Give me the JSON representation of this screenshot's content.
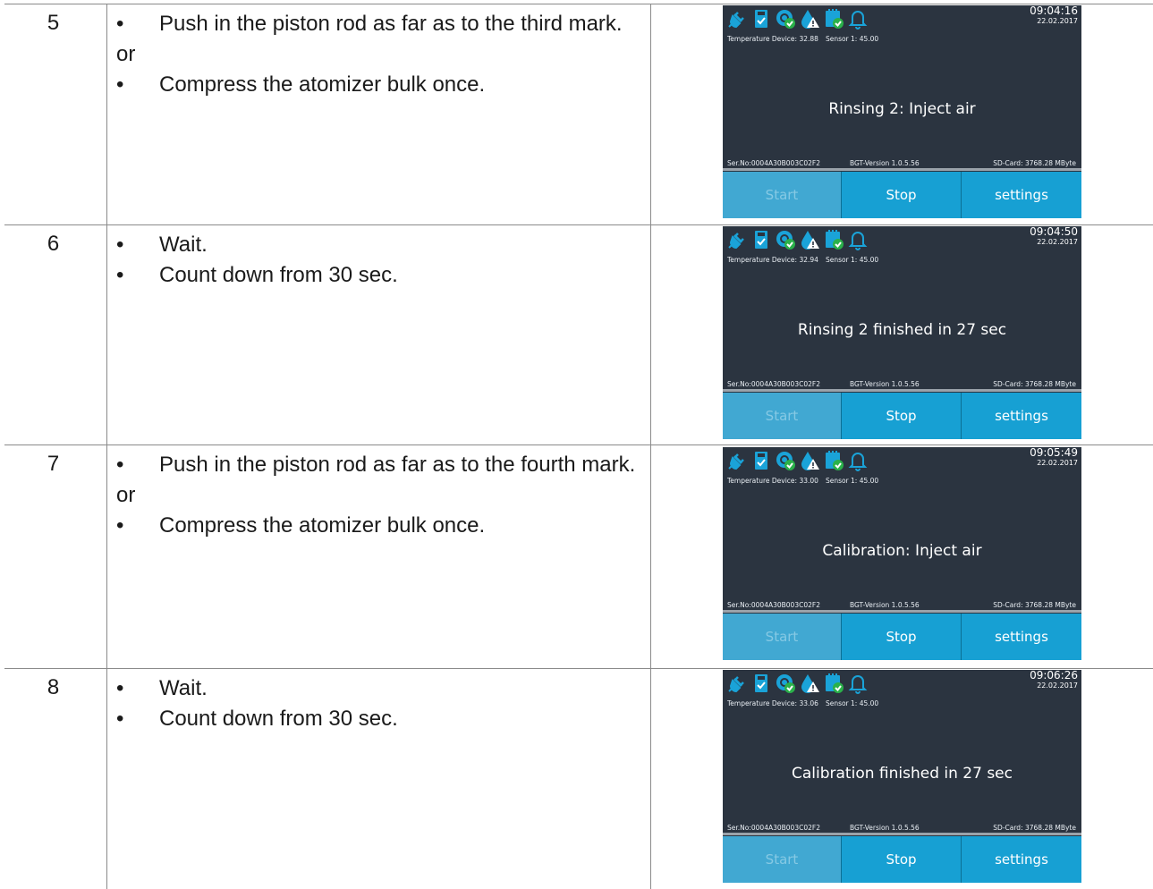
{
  "colors": {
    "screen_bg": "#2b3440",
    "button_active": "#17a0d3",
    "button_disabled": "#41a8d2",
    "icon_blue": "#1aa3d8",
    "icon_green": "#2bb14a"
  },
  "status_icons": [
    "plug-icon",
    "sd-card-check-icon",
    "fan-check-icon",
    "drop-warning-icon",
    "battery-check-icon",
    "bell-icon"
  ],
  "rows": [
    {
      "number": "5",
      "items": [
        {
          "type": "bullet",
          "bullet": "•",
          "text": "Push in the piston rod as far as to the third mark."
        },
        {
          "type": "or",
          "text": "or"
        },
        {
          "type": "bullet",
          "bullet": "•",
          "text": "Compress the atomizer bulk once."
        }
      ],
      "screen": {
        "time": "09:04:16",
        "date": "22.02.2017",
        "temperature": "Temperature Device: 32.88",
        "sensor": "Sensor 1: 45.00",
        "message": "Rinsing 2: Inject air",
        "serial": "Ser.No:0004A30B003C02F2",
        "version": "BGT-Version 1.0.5.56",
        "sdcard": "SD-Card: 3768.28 MByte",
        "btn_start": "Start",
        "btn_stop": "Stop",
        "btn_settings": "settings"
      }
    },
    {
      "number": "6",
      "items": [
        {
          "type": "bullet",
          "bullet": "•",
          "text": "Wait."
        },
        {
          "type": "bullet",
          "bullet": "•",
          "text": "Count down from 30 sec."
        }
      ],
      "screen": {
        "time": "09:04:50",
        "date": "22.02.2017",
        "temperature": "Temperature Device: 32.94",
        "sensor": "Sensor 1: 45.00",
        "message": "Rinsing 2 finished in 27 sec",
        "serial": "Ser.No:0004A30B003C02F2",
        "version": "BGT-Version 1.0.5.56",
        "sdcard": "SD-Card: 3768.28 MByte",
        "btn_start": "Start",
        "btn_stop": "Stop",
        "btn_settings": "settings"
      }
    },
    {
      "number": "7",
      "items": [
        {
          "type": "bullet",
          "bullet": "•",
          "text": "Push in the piston rod as far as to the fourth mark."
        },
        {
          "type": "or",
          "text": "or"
        },
        {
          "type": "bullet",
          "bullet": "•",
          "text": "Compress the atomizer bulk once."
        }
      ],
      "screen": {
        "time": "09:05:49",
        "date": "22.02.2017",
        "temperature": "Temperature Device: 33.00",
        "sensor": "Sensor 1: 45.00",
        "message": "Calibration: Inject air",
        "serial": "Ser.No:0004A30B003C02F2",
        "version": "BGT-Version 1.0.5.56",
        "sdcard": "SD-Card: 3768.28 MByte",
        "btn_start": "Start",
        "btn_stop": "Stop",
        "btn_settings": "settings"
      }
    },
    {
      "number": "8",
      "items": [
        {
          "type": "bullet",
          "bullet": "•",
          "text": "Wait."
        },
        {
          "type": "bullet",
          "bullet": "•",
          "text": "Count down from 30 sec."
        }
      ],
      "screen": {
        "time": "09:06:26",
        "date": "22.02.2017",
        "temperature": "Temperature Device: 33.06",
        "sensor": "Sensor 1: 45.00",
        "message": "Calibration finished in 27 sec",
        "serial": "Ser.No:0004A30B003C02F2",
        "version": "BGT-Version 1.0.5.56",
        "sdcard": "SD-Card: 3768.28 MByte",
        "btn_start": "Start",
        "btn_stop": "Stop",
        "btn_settings": "settings"
      }
    }
  ]
}
